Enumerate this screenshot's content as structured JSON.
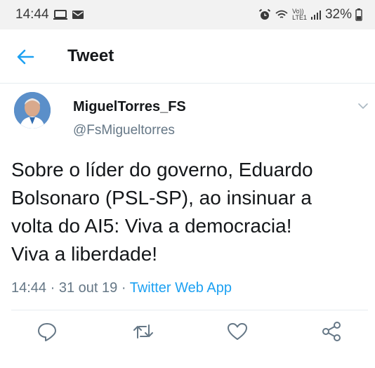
{
  "status_bar": {
    "time": "14:44",
    "network_label_top": "Vo))",
    "network_label_bottom": "LTE1",
    "battery": "32%"
  },
  "app_bar": {
    "title": "Tweet",
    "back_icon": "back-arrow-icon"
  },
  "tweet": {
    "author_name": "MiguelTorres_FS",
    "author_handle": "@FsMigueltorres",
    "text": "Sobre o líder do governo, Eduardo\nBolsonaro (PSL-SP), ao insinuar a\nvolta do AI5: Viva a democracia!\nViva a liberdade!",
    "time": "14:44",
    "separator": " · ",
    "date": "31 out 19",
    "source": "Twitter Web App"
  },
  "actions": {
    "reply_icon": "reply-icon",
    "retweet_icon": "retweet-icon",
    "like_icon": "heart-icon",
    "share_icon": "share-icon"
  },
  "colors": {
    "accent": "#1da1f2",
    "text_primary": "#14171a",
    "text_secondary": "#657786",
    "status_bar_bg": "#f2f2f2"
  }
}
